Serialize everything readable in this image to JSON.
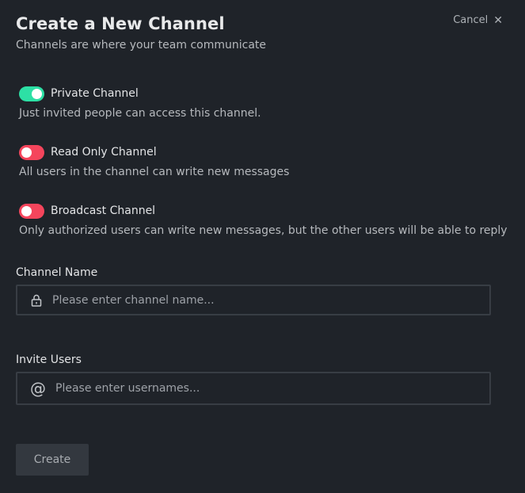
{
  "header": {
    "title": "Create a New Channel",
    "subtitle": "Channels are where your team communicate",
    "cancel_label": "Cancel",
    "cancel_icon": "close-icon"
  },
  "options": [
    {
      "label": "Private Channel",
      "description": "Just invited people can access this channel.",
      "enabled": true
    },
    {
      "label": "Read Only Channel",
      "description": "All users in the channel can write new messages",
      "enabled": false
    },
    {
      "label": "Broadcast Channel",
      "description": "Only authorized users can write new messages, but the other users will be able to reply",
      "enabled": false
    }
  ],
  "channel_name": {
    "label": "Channel Name",
    "value": "",
    "placeholder": "Please enter channel name...",
    "icon": "lock-icon"
  },
  "invite_users": {
    "label": "Invite Users",
    "value": "",
    "placeholder": "Please enter usernames...",
    "icon": "at-sign-icon"
  },
  "actions": {
    "create_label": "Create"
  },
  "colors": {
    "background": "#1f2329",
    "toggle_on": "#2de0a5",
    "toggle_off": "#f5455c",
    "input_border": "#383d44",
    "button_bg": "#33383f"
  }
}
